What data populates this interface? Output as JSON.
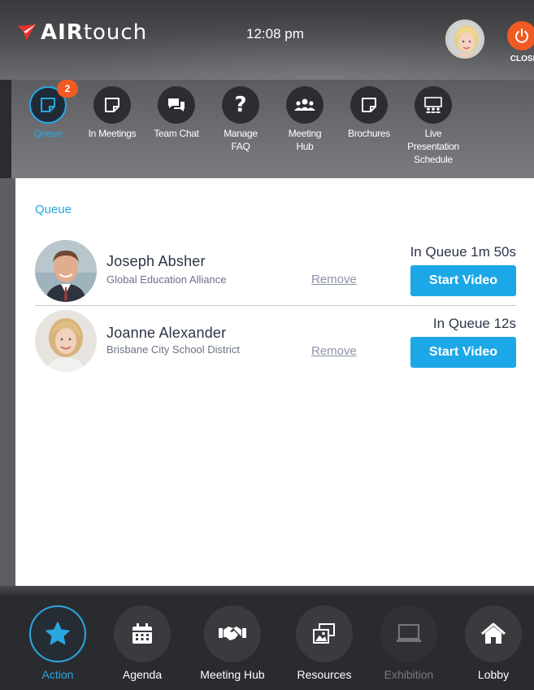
{
  "header": {
    "brand_bold": "AIR",
    "brand_light": "touch",
    "time": "12:08 pm",
    "close_label": "CLOSE",
    "accent_color": "#f15a22"
  },
  "tabs": [
    {
      "label": "Queue",
      "icon": "note-icon",
      "active": true,
      "badge": "2"
    },
    {
      "label": "In Meetings",
      "icon": "note-icon"
    },
    {
      "label": "Team Chat",
      "icon": "chat-icon"
    },
    {
      "label": "Manage FAQ",
      "icon": "question-icon"
    },
    {
      "label": "Meeting Hub",
      "icon": "people-icon"
    },
    {
      "label": "Brochures",
      "icon": "note-icon"
    },
    {
      "label": "Live Presentation Schedule",
      "icon": "presentation-icon"
    }
  ],
  "queue": {
    "title": "Queue",
    "entries": [
      {
        "name": "Joseph Absher",
        "org": "Global Education Alliance",
        "status": "In Queue 1m 50s",
        "remove_label": "Remove",
        "start_label": "Start Video"
      },
      {
        "name": "Joanne Alexander",
        "org": "Brisbane City School District",
        "status": "In Queue 12s",
        "remove_label": "Remove",
        "start_label": "Start Video"
      }
    ]
  },
  "bottom_nav": [
    {
      "label": "Action",
      "icon": "star-icon",
      "active": true
    },
    {
      "label": "Agenda",
      "icon": "calendar-icon"
    },
    {
      "label": "Meeting Hub",
      "icon": "handshake-icon"
    },
    {
      "label": "Resources",
      "icon": "images-icon"
    },
    {
      "label": "Exhibition",
      "icon": "monitor-icon",
      "disabled": true
    },
    {
      "label": "Lobby",
      "icon": "home-icon"
    }
  ],
  "colors": {
    "accent_blue": "#2aa7e0",
    "button_blue": "#1ca7e7",
    "badge_orange": "#f15a22"
  }
}
